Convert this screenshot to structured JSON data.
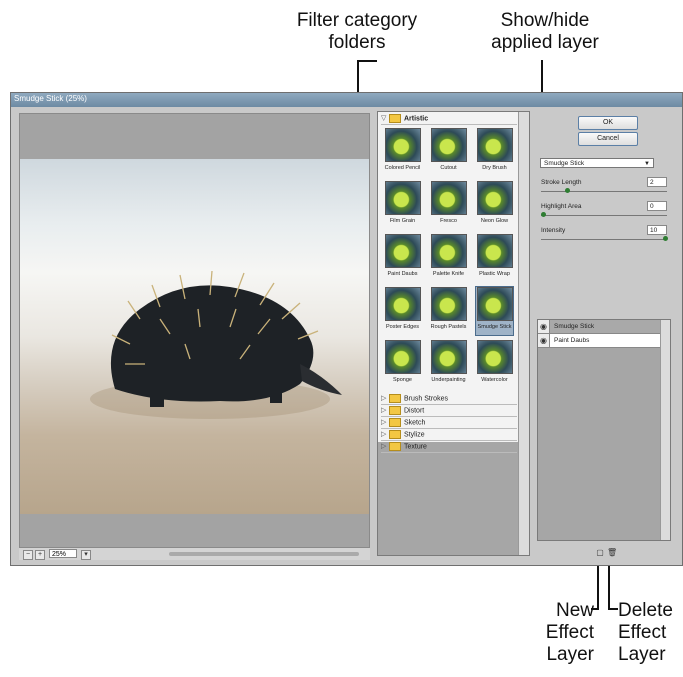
{
  "callouts": {
    "filter_category_folders": "Filter category\nfolders",
    "show_hide_layer": "Show/hide\napplied layer",
    "new_effect_layer": "New\nEffect\nLayer",
    "delete_effect_layer": "Delete\nEffect\nLayer"
  },
  "window": {
    "title": "Smudge Stick (25%)"
  },
  "preview": {
    "zoom": "25%",
    "zoom_out_icon": "minus-icon",
    "zoom_in_icon": "plus-icon"
  },
  "filter_gallery": {
    "open_folder": "Artistic",
    "thumbnails": [
      "Colored Pencil",
      "Cutout",
      "Dry Brush",
      "Film Grain",
      "Fresco",
      "Neon Glow",
      "Paint Daubs",
      "Palette Knife",
      "Plastic Wrap",
      "Poster Edges",
      "Rough Pastels",
      "Smudge Stick",
      "Sponge",
      "Underpainting",
      "Watercolor"
    ],
    "selected": "Smudge Stick",
    "folders": [
      "Brush Strokes",
      "Distort",
      "Sketch",
      "Stylize",
      "Texture"
    ]
  },
  "buttons": {
    "ok": "OK",
    "cancel": "Cancel"
  },
  "settings": {
    "filter_select": "Smudge Stick",
    "params": [
      {
        "label": "Stroke Length",
        "value": "2",
        "level": 0.2
      },
      {
        "label": "Highlight Area",
        "value": "0",
        "level": 0.0
      },
      {
        "label": "Intensity",
        "value": "10",
        "level": 1.0
      }
    ]
  },
  "layers": [
    {
      "name": "Smudge Stick"
    },
    {
      "name": "Paint Daubs"
    }
  ],
  "icons": {
    "eye": "eye-icon",
    "new_layer": "new-effect-layer-icon",
    "delete_layer": "trash-icon"
  }
}
